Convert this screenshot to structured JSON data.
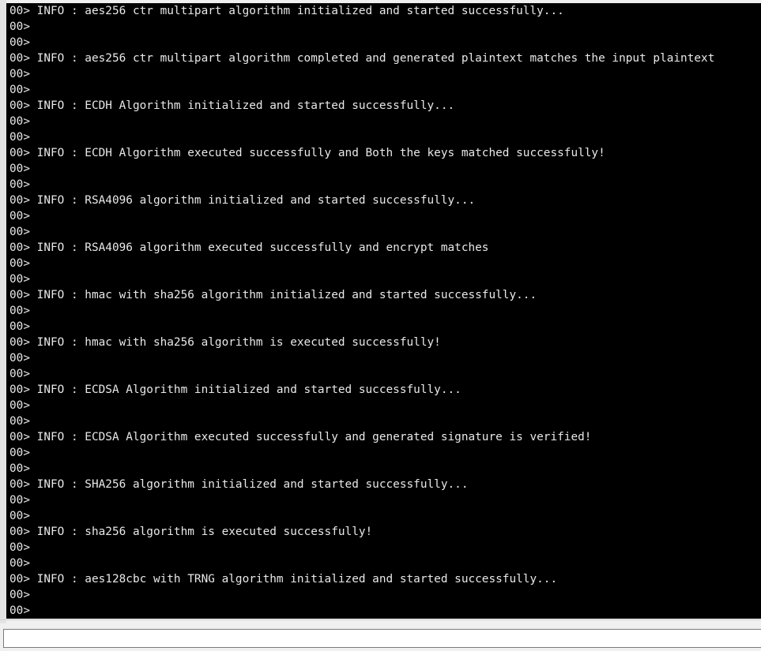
{
  "console": {
    "lines": [
      "00> INFO : aes256 ctr multipart algorithm initialized and started successfully...",
      "00>",
      "00>",
      "00> INFO : aes256 ctr multipart algorithm completed and generated plaintext matches the input plaintext",
      "00>",
      "00>",
      "00> INFO : ECDH Algorithm initialized and started successfully...",
      "00>",
      "00>",
      "00> INFO : ECDH Algorithm executed successfully and Both the keys matched successfully!",
      "00>",
      "00>",
      "00> INFO : RSA4096 algorithm initialized and started successfully...",
      "00>",
      "00>",
      "00> INFO : RSA4096 algorithm executed successfully and encrypt matches",
      "00>",
      "00>",
      "00> INFO : hmac with sha256 algorithm initialized and started successfully...",
      "00>",
      "00>",
      "00> INFO : hmac with sha256 algorithm is executed successfully!",
      "00>",
      "00>",
      "00> INFO : ECDSA Algorithm initialized and started successfully...",
      "00>",
      "00>",
      "00> INFO : ECDSA Algorithm executed successfully and generated signature is verified!",
      "00>",
      "00>",
      "00> INFO : SHA256 algorithm initialized and started successfully...",
      "00>",
      "00>",
      "00> INFO : sha256 algorithm is executed successfully!",
      "00>",
      "00>",
      "00> INFO : aes128cbc with TRNG algorithm initialized and started successfully...",
      "00>",
      "00>"
    ]
  },
  "input": {
    "value": "",
    "placeholder": ""
  },
  "colors": {
    "terminal_background": "#000000",
    "terminal_text": "#e8e8e8",
    "window_background": "#f0f0f0"
  }
}
